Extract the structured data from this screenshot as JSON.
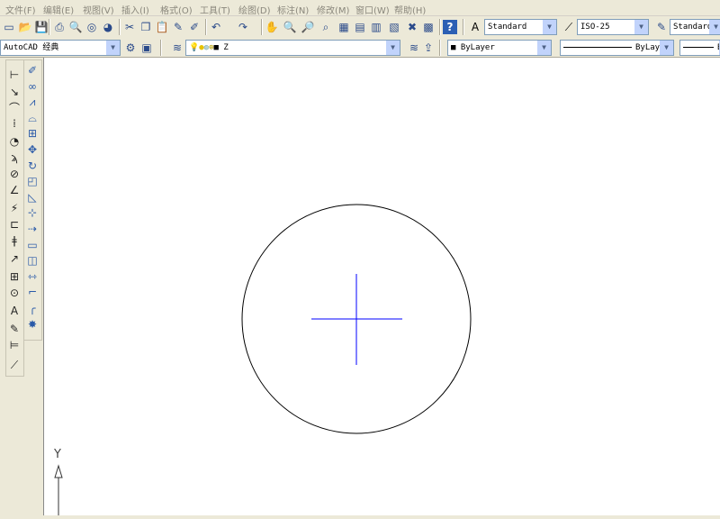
{
  "menu": [
    "文件(F)",
    "编辑(E)",
    "视图(V)",
    "插入(I)",
    "格式(O)",
    "工具(T)",
    "绘图(D)",
    "标注(N)",
    "修改(M)",
    "窗口(W)",
    "帮助(H)"
  ],
  "toolbar1": {
    "icons": [
      "new-icon",
      "open-icon",
      "save-icon",
      "plot-icon",
      "plot-preview-icon",
      "publish-icon",
      "3d-dwf-icon",
      "cut-icon",
      "copy-icon",
      "paste-icon",
      "match-properties-icon",
      "block-editor-icon",
      "undo-icon",
      "redo-icon",
      "pan-icon",
      "zoom-realtime-icon",
      "zoom-window-icon",
      "zoom-previous-icon",
      "properties-icon",
      "design-center-icon",
      "tool-palettes-icon",
      "sheet-set-icon",
      "markup-icon",
      "calculator-icon",
      "help-icon"
    ],
    "text_style": "Standard",
    "dim_style": "ISO-25",
    "table_style": "Standard"
  },
  "toolbar2": {
    "workspace": "AutoCAD 经典",
    "layer": "Z",
    "color": "ByLayer",
    "linetype": "ByLayer",
    "lineweight": "ByLayer"
  },
  "dim_toolbar": [
    "linear-dim-icon",
    "aligned-dim-icon",
    "arc-length-icon",
    "ordinate-icon",
    "radius-icon",
    "jogged-icon",
    "diameter-icon",
    "angular-icon",
    "quick-dim-icon",
    "baseline-icon",
    "continue-icon",
    "quick-leader-icon",
    "tolerance-icon",
    "center-mark-icon",
    "dim-edit-icon",
    "dim-text-edit-icon",
    "dim-update-icon",
    "dim-style-icon"
  ],
  "modify_toolbar": [
    "erase-icon",
    "copy-object-icon",
    "mirror-icon",
    "offset-icon",
    "array-icon",
    "move-icon",
    "rotate-icon",
    "scale-icon",
    "stretch-icon",
    "trim-icon",
    "extend-icon",
    "break-at-point-icon",
    "break-icon",
    "join-icon",
    "chamfer-icon",
    "fillet-icon",
    "explode-icon"
  ],
  "ucs": {
    "y_label": "Y"
  },
  "colors": {
    "crosshair": "#0000ff",
    "circle": "#000000"
  }
}
